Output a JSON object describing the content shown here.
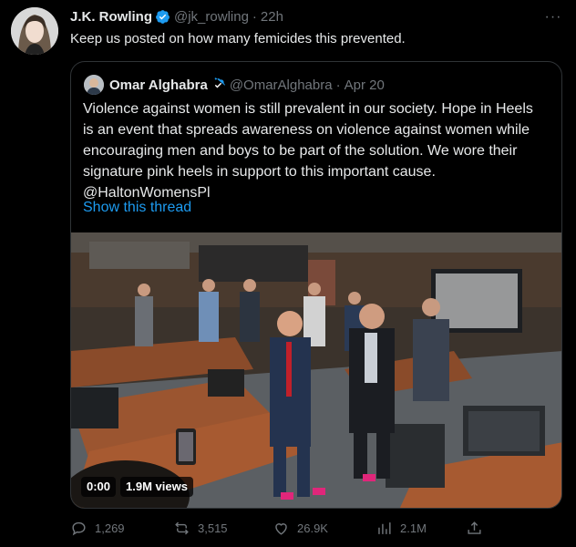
{
  "tweet": {
    "author_name": "J.K. Rowling",
    "handle": "@jk_rowling",
    "separator": "·",
    "time": "22h",
    "text": "Keep us posted on how many femicides this prevented.",
    "more_label": "···"
  },
  "quoted": {
    "author_name": "Omar Alghabra",
    "handle": "@OmarAlghabra",
    "separator": "·",
    "time": "Apr 20",
    "lines": [
      "Violence against women is still prevalent in our society. Hope in Heels",
      "is an event that spreads awareness on violence against women while",
      "encouraging men and boys to be part of the solution. We wore their",
      "signature pink heels in support to this important cause.",
      "@HaltonWomensPl"
    ],
    "show_thread": "Show this thread",
    "video": {
      "duration": "0:00",
      "views": "1.9M views"
    }
  },
  "actions": {
    "replies": "1,269",
    "retweets": "3,515",
    "likes": "26.9K",
    "views": "2.1M"
  },
  "colors": {
    "background": "#000000",
    "text": "#e7e9ea",
    "muted": "#71767b",
    "link": "#1d9bf0",
    "verified": "#1d9bf0",
    "border": "#2f3336"
  },
  "icons": [
    "verified-badge-icon",
    "more-icon",
    "reply-icon",
    "retweet-icon",
    "like-icon",
    "views-icon",
    "share-icon"
  ]
}
